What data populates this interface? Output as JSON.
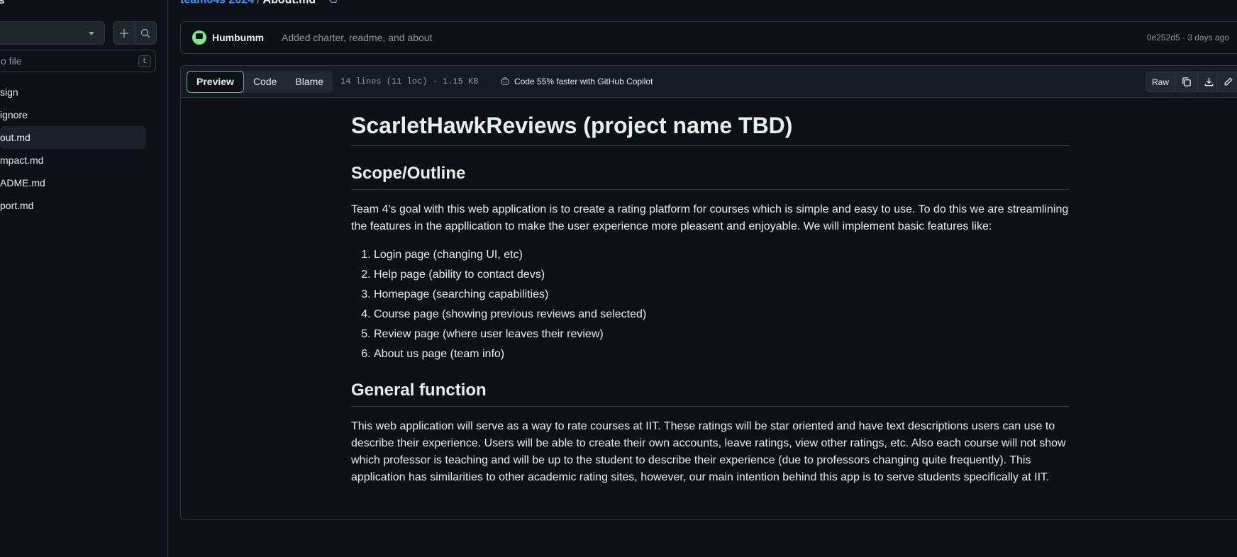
{
  "sidebar": {
    "top_glyph": "s",
    "add_icon": "plus-icon",
    "search_icon": "search-icon",
    "filter_placeholder": "o file",
    "filter_shortcut": "t",
    "files": [
      {
        "label": "sign",
        "active": false
      },
      {
        "label": "ignore",
        "active": false
      },
      {
        "label": "out.md",
        "active": true
      },
      {
        "label": "mpact.md",
        "active": false
      },
      {
        "label": "ADME.md",
        "active": false
      },
      {
        "label": "port.md",
        "active": false
      }
    ]
  },
  "breadcrumb": {
    "repo": "team04s 2024",
    "separator": "/",
    "file": "About.md"
  },
  "commit": {
    "author": "Humbumm",
    "message": "Added charter, readme, and about",
    "meta": "0e252d5 · 3 days ago"
  },
  "file_header": {
    "tabs": [
      "Preview",
      "Code",
      "Blame"
    ],
    "info": "14 lines (11 loc) · 1.15 KB",
    "copilot": "Code 55% faster with GitHub Copilot",
    "raw_label": "Raw"
  },
  "doc": {
    "title": "ScarletHawkReviews (project name TBD)",
    "h_scope": "Scope/Outline",
    "p_scope": "Team 4's goal with this web application is to create a rating platform for courses which is simple and easy to use. To do this we are streamlining the features in the appllication to make the user experience more pleasent and enjoyable. We will implement basic features like:",
    "list": [
      "Login page (changing UI, etc)",
      "Help page (ability to contact devs)",
      "Homepage (searching capabilities)",
      "Course page (showing previous reviews and selected)",
      "Review page (where user leaves their review)",
      "About us page (team info)"
    ],
    "h_general": "General function",
    "p_general": "This web application will serve as a way to rate courses at IIT. These ratings will be star oriented and have text descriptions users can use to describe their experience. Users will be able to create their own accounts, leave ratings, view other ratings, etc. Also each course will not show which professor is teaching and will be up to the student to describe their experience (due to professors changing quite frequently). This application has similarities to other academic rating sites, however, our main intention behind this app is to serve students specifically at IIT."
  }
}
